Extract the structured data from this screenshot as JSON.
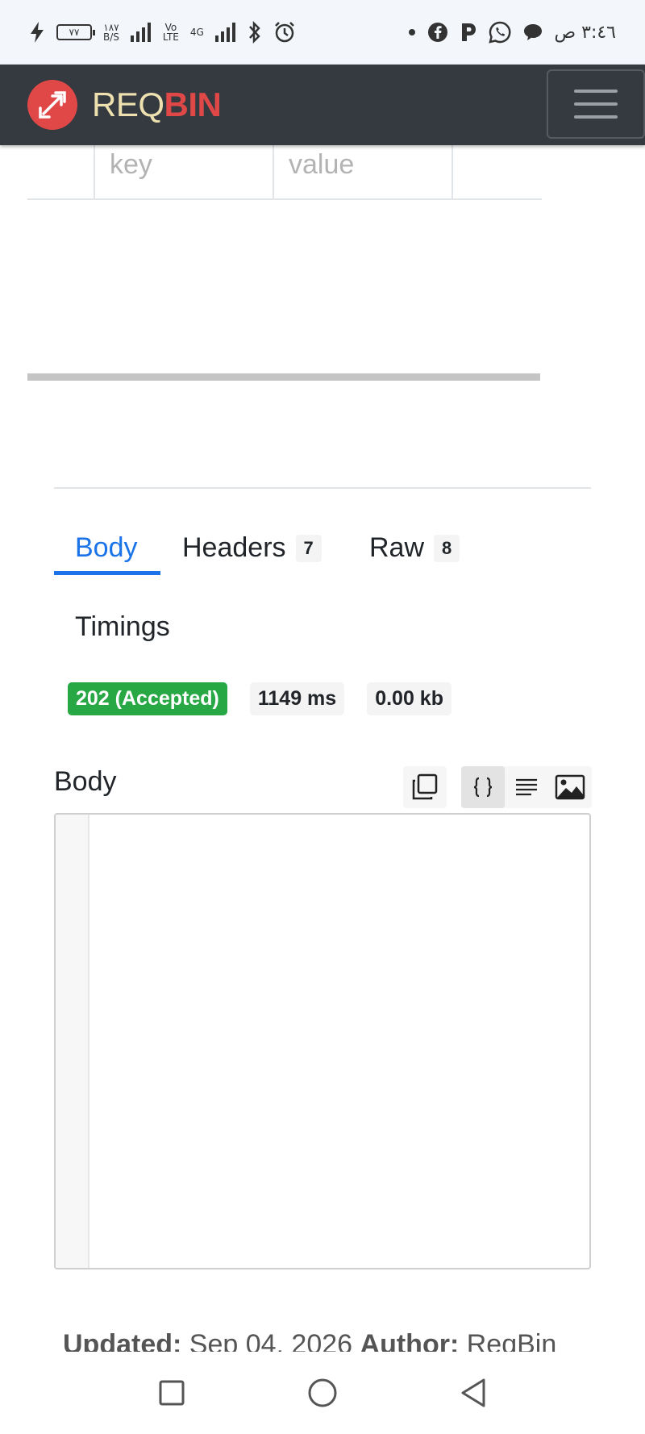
{
  "status_bar": {
    "time": "٣:٤٦ ص",
    "battery": "٧٧",
    "speed_value": "١٨٧",
    "speed_unit": "B/S",
    "volte_top": "Vo",
    "volte_bottom": "LTE",
    "network": "4G"
  },
  "navbar": {
    "brand_req": "REQ",
    "brand_bin": "BIN",
    "accent_color": "#e04848"
  },
  "params": {
    "key_placeholder": "key",
    "value_placeholder": "value"
  },
  "response": {
    "tabs": [
      {
        "label": "Body",
        "count": ""
      },
      {
        "label": "Headers",
        "count": "7"
      },
      {
        "label": "Raw",
        "count": "8"
      },
      {
        "label": "Timings",
        "count": ""
      }
    ],
    "status": "202 (Accepted)",
    "time": "1149 ms",
    "size": "0.00 kb",
    "status_color": "#28a745"
  },
  "body_section": {
    "title": "Body"
  },
  "footer": {
    "updated_label": "Updated:",
    "updated_value": "Sep 04, 2026",
    "author_label": "Author:",
    "author_value": "ReqBin"
  }
}
